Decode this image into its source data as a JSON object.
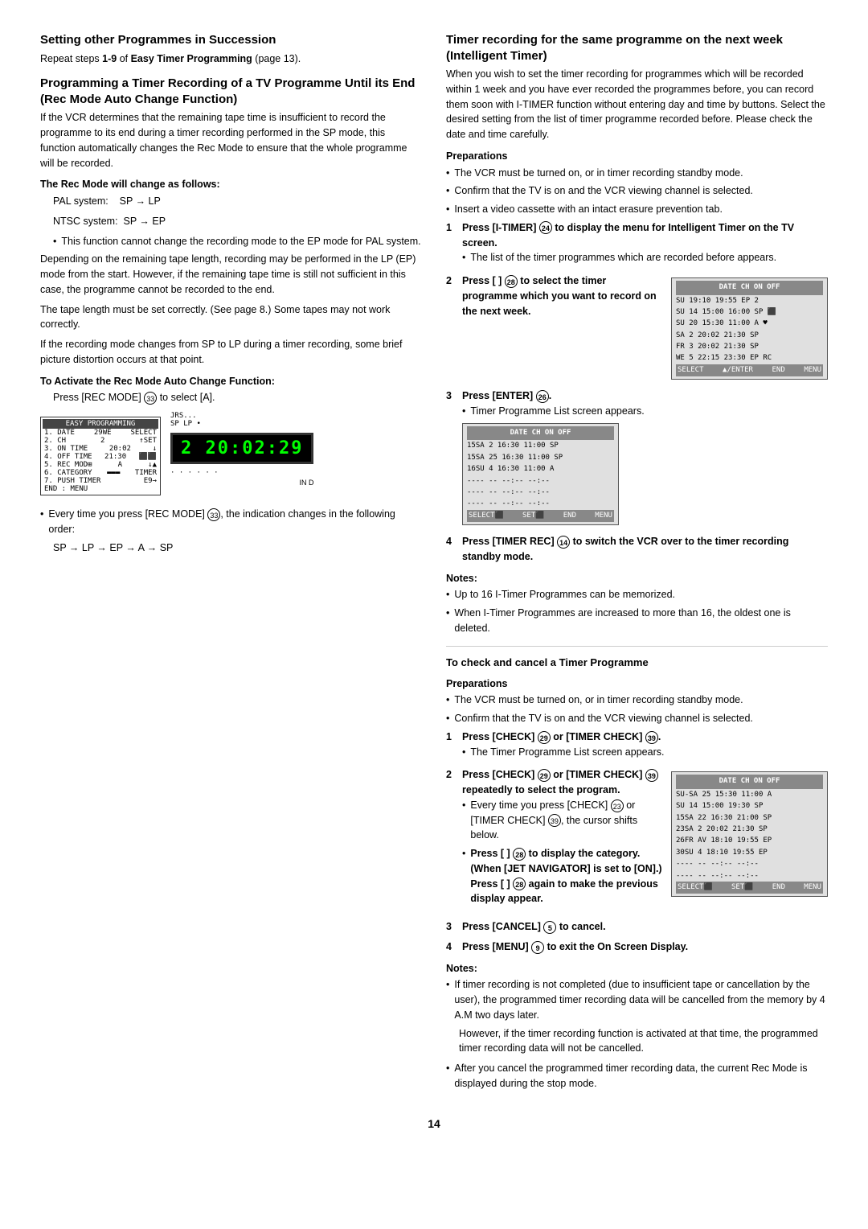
{
  "page": {
    "number": "14",
    "left_column": {
      "section1": {
        "title": "Setting other Programmes in Succession",
        "body": "Repeat steps 1-9 of Easy Timer Programming (page 13)."
      },
      "section2": {
        "title": "Programming a Timer Recording of a TV Programme Until its End (Rec Mode Auto Change Function)",
        "body": "If the VCR determines that the remaining tape time is insufficient to record the programme to its end during a timer recording performed in the SP mode, this function automatically changes the Rec Mode to ensure that the whole programme will be recorded.",
        "rec_mode_label": "The Rec Mode will change as follows:",
        "pal": "PAL system:    SP → LP",
        "ntsc": "NTSC system:  SP → EP",
        "note1": "This function cannot change the recording mode to the EP mode for PAL system.",
        "body2": "Depending on the remaining tape length, recording may be performed in the LP (EP) mode from the start. However, if the remaining tape time is still not sufficient in this case, the programme cannot be recorded to the end.",
        "body3": "The tape length must be set correctly. (See page 8.) Some tapes may not work correctly.",
        "body4": "If the recording mode changes from SP to LP during a timer recording, some brief picture distortion occurs at that point.",
        "activate_label": "To Activate the Rec Mode Auto Change Function:",
        "activate_body": "Press [REC MODE] (33) to select [A].",
        "display_text": "2 20:02:29",
        "display_sub": "SP LP •",
        "display_note1": "JRS...",
        "every_press_note": "Every time you press [REC MODE] (33), the indication changes in the following order:",
        "formula": "SP → LP → EP → A → SP"
      }
    },
    "right_column": {
      "section3": {
        "title": "Timer recording for the same programme on the next week (Intelligent Timer)",
        "intro": "When you wish to set the timer recording for programmes which will be recorded within 1 week and you have ever recorded the programmes before, you can record them soon with I-TIMER function without entering day and time by buttons. Select the desired setting from the list of timer programme recorded before. Please check the date and time carefully.",
        "preparations_label": "Preparations",
        "prep1": "The VCR must be turned on, or in timer recording standby mode.",
        "prep2": "Confirm that the TV is on and the VCR viewing channel is selected.",
        "prep3": "Insert a video cassette with an intact erasure prevention tab.",
        "step1": "Press [I-TIMER] (24) to display the menu for Intelligent Timer on the TV screen.",
        "step1_note": "The list of the timer programmes which are recorded before appears.",
        "step2_label": "Press [ ] (28) to select the timer programme which you want to record on the next week.",
        "step3_label": "Press [ENTER] (26).",
        "step3_note": "Timer Programme List screen appears.",
        "step4_label": "Press [TIMER REC] (14) to switch the VCR over to the timer recording standby mode.",
        "notes_label": "Notes:",
        "note1": "Up to 16 I-Timer Programmes can be memorized.",
        "note2": "When I-Timer Programmes are increased to more than 16, the oldest one is deleted."
      },
      "section4": {
        "title": "To check and cancel a Timer Programme",
        "preparations_label": "Preparations",
        "prep1": "The VCR must be turned on, or in timer recording standby mode.",
        "prep2": "Confirm that the TV is on and the VCR viewing channel is selected.",
        "step1": "Press [CHECK] (29) or [TIMER CHECK] (39).",
        "step1_note": "The Timer Programme List screen appears.",
        "step2": "Press [CHECK] (29) or [TIMER CHECK] (39) repeatedly to select the program.",
        "step2_note": "Every time you press [CHECK] (23) or [TIMER CHECK] (39), the cursor shifts below.",
        "bullet_cat": "Press [ ] (28) to display the category. (When [JET NAVIGATOR] is set to [ON].) Press [ ] (28) again to make the previous display appear.",
        "step3": "Press [CANCEL] (5) to cancel.",
        "step4": "Press [MENU] (9) to exit the On Screen Display.",
        "notes_label": "Notes:",
        "final_note1": "If timer recording is not completed (due to insufficient tape or cancellation by the user), the programmed timer recording data will be cancelled from the memory by 4 A.M two days later.",
        "final_note2": "However, if the timer recording function is activated at that time, the programmed timer recording data will not be cancelled.",
        "final_note3": "After you cancel the programmed timer recording data, the current Rec Mode is displayed during the stop mode."
      }
    }
  }
}
